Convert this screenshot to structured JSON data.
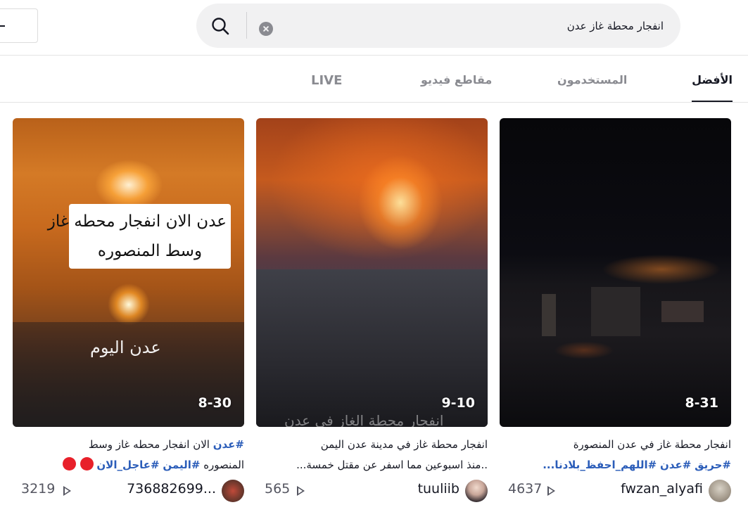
{
  "search": {
    "query": "انفجار محطة غاز عدن"
  },
  "tabs": [
    {
      "label": "الأفضل",
      "active": true
    },
    {
      "label": "المستخدمون",
      "active": false
    },
    {
      "label": "مقاطع فيديو",
      "active": false
    },
    {
      "label": "LIVE",
      "active": false
    }
  ],
  "videos": [
    {
      "date": "8-31",
      "desc_line1": "انفجار محطة غاز في عدن المنصورة",
      "tags": [
        "#حريق",
        "#عدن",
        "#اللهم_احفظ_بلادنا..."
      ],
      "username": "fwzan_alyafi",
      "views": "4637"
    },
    {
      "date": "9-10",
      "desc_line1": "انفجار محطة غاز في مدينة عدن اليمن",
      "desc_line2": "..منذ اسبوعين مما اسفر عن مقتل خمسة...",
      "overlay_bottom": "انفجار محطة الغاز في عدن",
      "username": "tuuliib",
      "views": "565"
    },
    {
      "date": "8-30",
      "desc_tag1": "#عدن",
      "desc_line1_rest": " الان انفجار محطه غاز وسط",
      "desc_line2_text": "المنصوره ",
      "desc_tag2": "#اليمن",
      "desc_tag3": "#عاجل_الان",
      "overlay_line1": "عدن الان انفجار محطه غاز",
      "overlay_line2": "وسط المنصوره",
      "overlay_sub": "عدن اليوم",
      "username": "736882699...",
      "views": "3219"
    }
  ],
  "icons": {
    "search": "search-icon",
    "clear": "clear-icon",
    "play": "play-icon"
  },
  "colors": {
    "hashtag": "#2b5db9",
    "text": "#161823",
    "muted": "#8a8b91",
    "emoji_red": "#e8202a"
  }
}
